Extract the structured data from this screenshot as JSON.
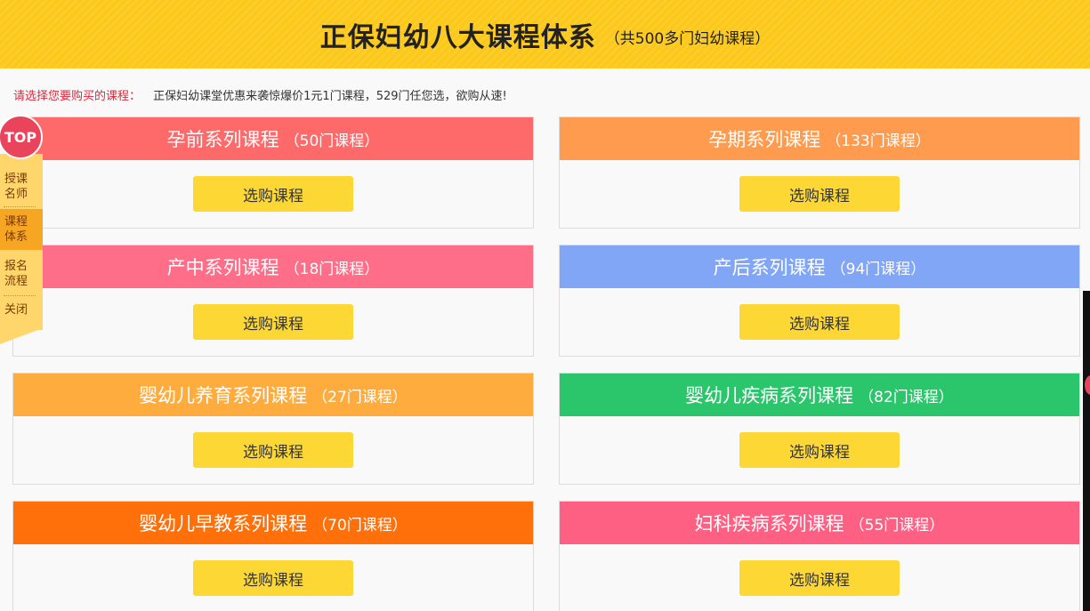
{
  "banner": {
    "title": "正保妇幼八大课程体系",
    "subtitle": "（共500多门妇幼课程）"
  },
  "notice": {
    "label": "请选择您要购买的课程：",
    "text": "正保妇幼课堂优惠来袭惊爆价1元1门课程，529门任您选，欲购从速!"
  },
  "cards": [
    {
      "title": "孕前系列课程",
      "count": "（50门课程）",
      "button": "选购课程",
      "color": "#fe6a6a"
    },
    {
      "title": "孕期系列课程",
      "count": "（133门课程）",
      "button": "选购课程",
      "color": "#ff9b4e"
    },
    {
      "title": "产中系列课程",
      "count": "（18门课程）",
      "button": "选购课程",
      "color": "#fe6e88"
    },
    {
      "title": "产后系列课程",
      "count": "（94门课程）",
      "button": "选购课程",
      "color": "#81a6f6"
    },
    {
      "title": "婴幼儿养育系列课程",
      "count": "（27门课程）",
      "button": "选购课程",
      "color": "#ffac3f"
    },
    {
      "title": "婴幼儿疾病系列课程",
      "count": "（82门课程）",
      "button": "选购课程",
      "color": "#2bc56b"
    },
    {
      "title": "婴幼儿早教系列课程",
      "count": "（70门课程）",
      "button": "选购课程",
      "color": "#ff700a"
    },
    {
      "title": "妇科疾病系列课程",
      "count": "（55门课程）",
      "button": "选购课程",
      "color": "#fe6083"
    }
  ],
  "sidenav": {
    "top": "TOP",
    "items": [
      {
        "line1": "授课",
        "line2": "名师"
      },
      {
        "line1": "课程",
        "line2": "体系"
      },
      {
        "line1": "报名",
        "line2": "流程"
      },
      {
        "line1": "关闭",
        "line2": ""
      }
    ]
  }
}
